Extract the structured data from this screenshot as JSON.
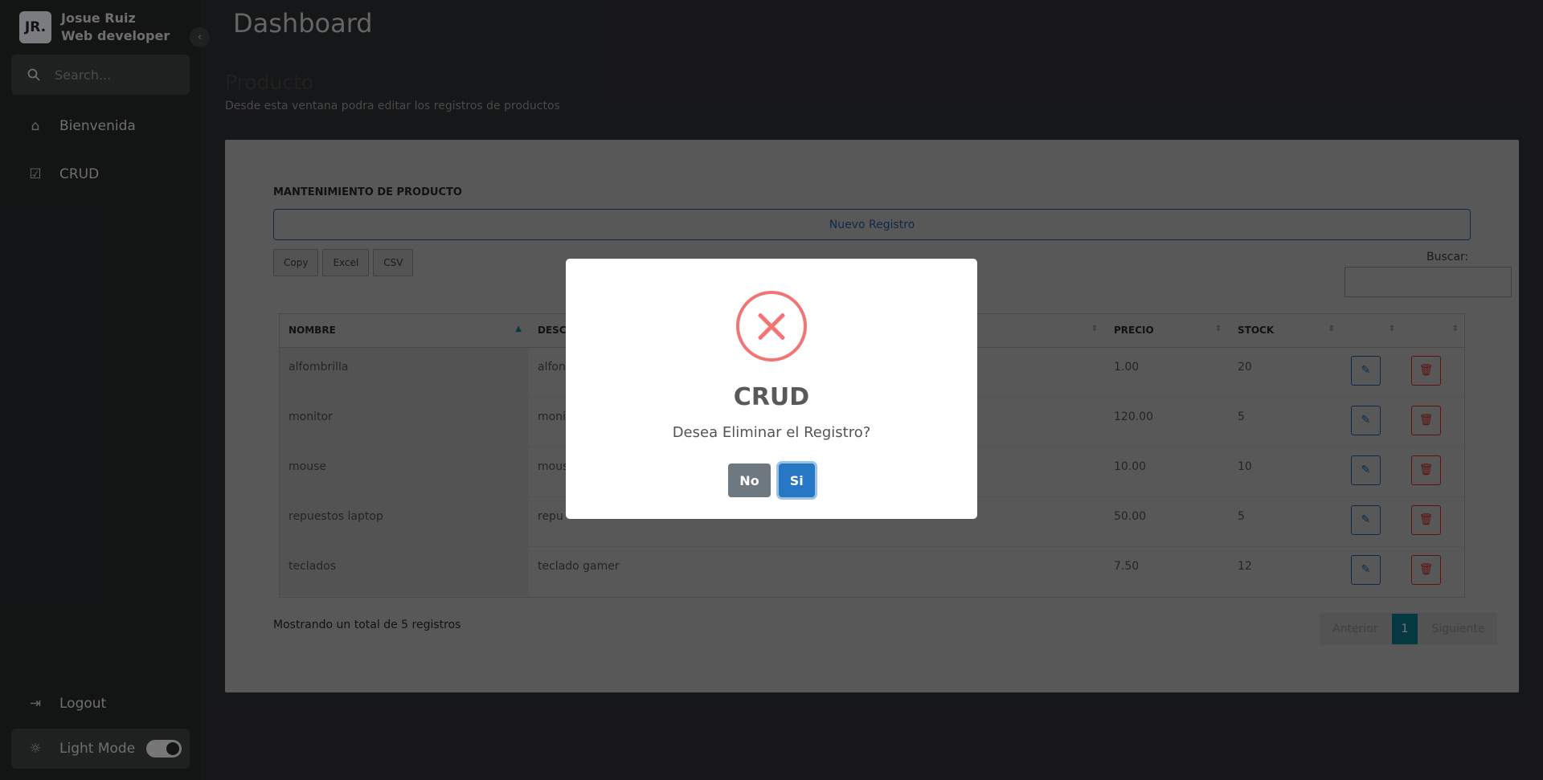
{
  "profile": {
    "name": "Josue Ruiz",
    "role": "Web developer",
    "avatar": "JR."
  },
  "search": {
    "placeholder": "Search..."
  },
  "nav": [
    {
      "label": "Bienvenida",
      "icon": "home-icon"
    },
    {
      "label": "CRUD",
      "icon": "calendar-check-icon"
    }
  ],
  "bottom": {
    "logout": "Logout",
    "mode": "Light Mode"
  },
  "header": {
    "title": "Dashboard"
  },
  "section": {
    "title": "Producto",
    "subtitle": "Desde esta ventana podra editar los registros de productos"
  },
  "card": {
    "title": "MANTENIMIENTO DE PRODUCTO",
    "new_button": "Nuevo Registro",
    "export": [
      "Copy",
      "Excel",
      "CSV"
    ],
    "search_label": "Buscar:"
  },
  "table": {
    "headers": [
      "NOMBRE",
      "DESC",
      "PRECIO",
      "STOCK"
    ],
    "rows": [
      {
        "nombre": "alfombrilla",
        "desc": "alfon",
        "precio": "1.00",
        "stock": "20"
      },
      {
        "nombre": "monitor",
        "desc": "moni",
        "precio": "120.00",
        "stock": "5"
      },
      {
        "nombre": "mouse",
        "desc": "mous",
        "precio": "10.00",
        "stock": "10"
      },
      {
        "nombre": "repuestos laptop",
        "desc": "repu",
        "precio": "50.00",
        "stock": "5"
      },
      {
        "nombre": "teclados",
        "desc": "teclado gamer",
        "precio": "7.50",
        "stock": "12"
      }
    ]
  },
  "footer": {
    "info": "Mostrando un total de 5 registros"
  },
  "pager": {
    "prev": "Anterior",
    "current": "1",
    "next": "Siguiente"
  },
  "dialog": {
    "title": "CRUD",
    "text": "Desea Eliminar el Registro?",
    "no": "No",
    "si": "Si"
  }
}
